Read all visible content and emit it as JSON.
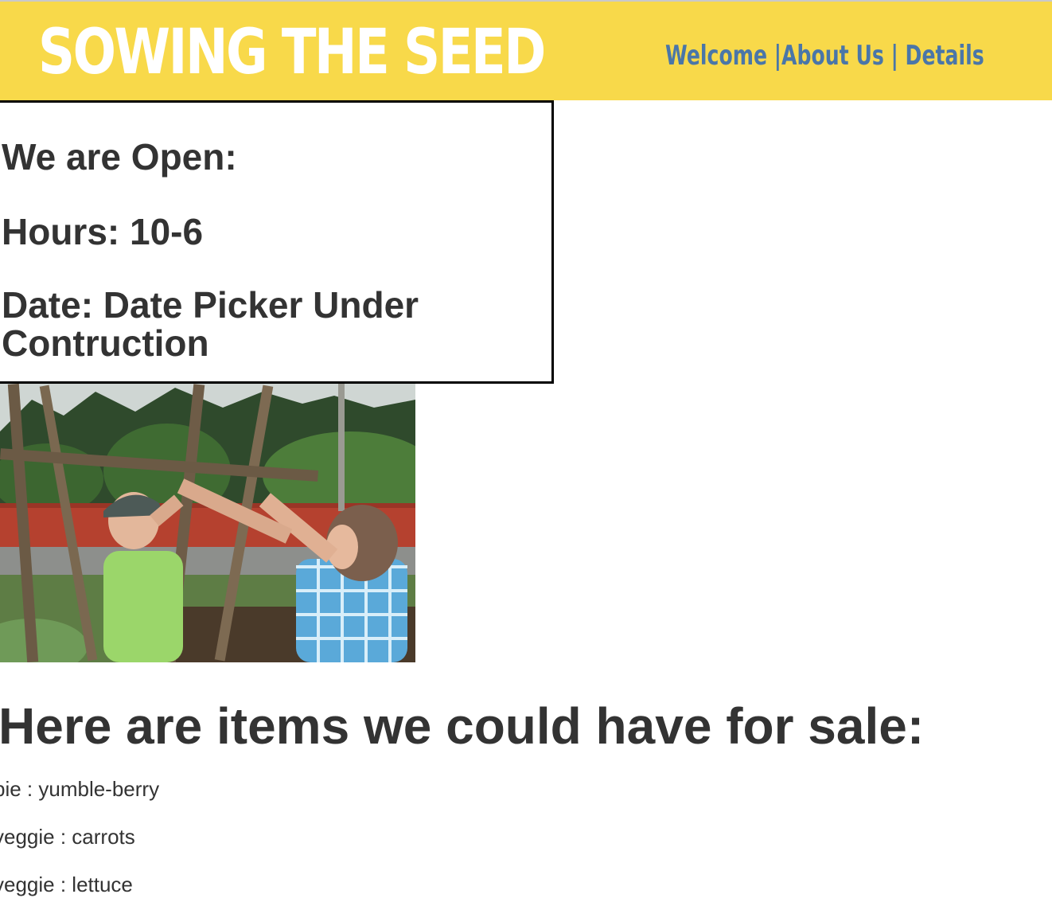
{
  "header": {
    "title": "SOWING THE SEED",
    "nav": [
      {
        "label": "Welcome |"
      },
      {
        "label": "About Us"
      },
      {
        "label": " | "
      },
      {
        "label": "Details"
      }
    ],
    "background_color": "#f8d94a",
    "nav_color": "#4a76a8"
  },
  "hours_box": {
    "open_label": "We are Open:",
    "hours_label": "Hours: 10-6",
    "date_label": "Date: Date Picker Under Contruction"
  },
  "photo": {
    "icon": "garden-photo"
  },
  "sale": {
    "heading": "Here are items we could have for sale:",
    "items": [
      {
        "text": "pie : yumble-berry"
      },
      {
        "text": "veggie : carrots"
      },
      {
        "text": "veggie : lettuce"
      }
    ]
  }
}
